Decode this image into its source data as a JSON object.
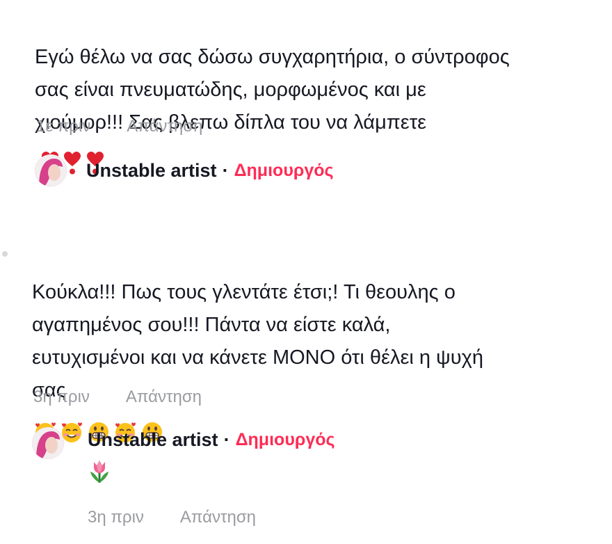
{
  "comments": [
    {
      "text": "Εγώ θέλω να σας δώσω συγχαρητήρια, ο σύντροφος\nσας είναι πνευματώδης, μορφωμένος και με\nχιούμορ!!! Σας βλεπω δίπλα του να λάμπετε",
      "emojis": [
        "heart-exclamation-icon",
        "heart-exclamation-icon",
        "heart-exclamation-icon"
      ],
      "time": "1ε πριν",
      "reply_label": "Απάντηση",
      "reply": {
        "author": "Unstable artist",
        "separator": "·",
        "badge": "Δημιουργός",
        "text": "",
        "time": "",
        "reply_label": ""
      }
    },
    {
      "text": "Κούκλα!!! Πως τους γλεντάτε έτσι;! Τι θεουλης ο\nαγαπημένος σου!!! Πάντα να είστε καλά,\nευτυχισμένοι και να κάνετε ΜΟΝΟ ότι θέλει η ψυχή\nσας",
      "emojis": [
        "smiling-hearts-icon",
        "smiling-hearts-icon",
        "grinning-icon",
        "smiling-hearts-icon",
        "grinning-icon"
      ],
      "time": "3η πριν",
      "reply_label": "Απάντηση",
      "reply": {
        "author": "Unstable artist",
        "separator": "·",
        "badge": "Δημιουργός",
        "emoji": "tulip-icon",
        "time": "3η πριν",
        "reply_label": "Απάντηση"
      }
    }
  ],
  "colors": {
    "text": "#161823",
    "muted": "#9a9ba0",
    "creator": "#fe2c55",
    "heart": "#e0212f"
  }
}
